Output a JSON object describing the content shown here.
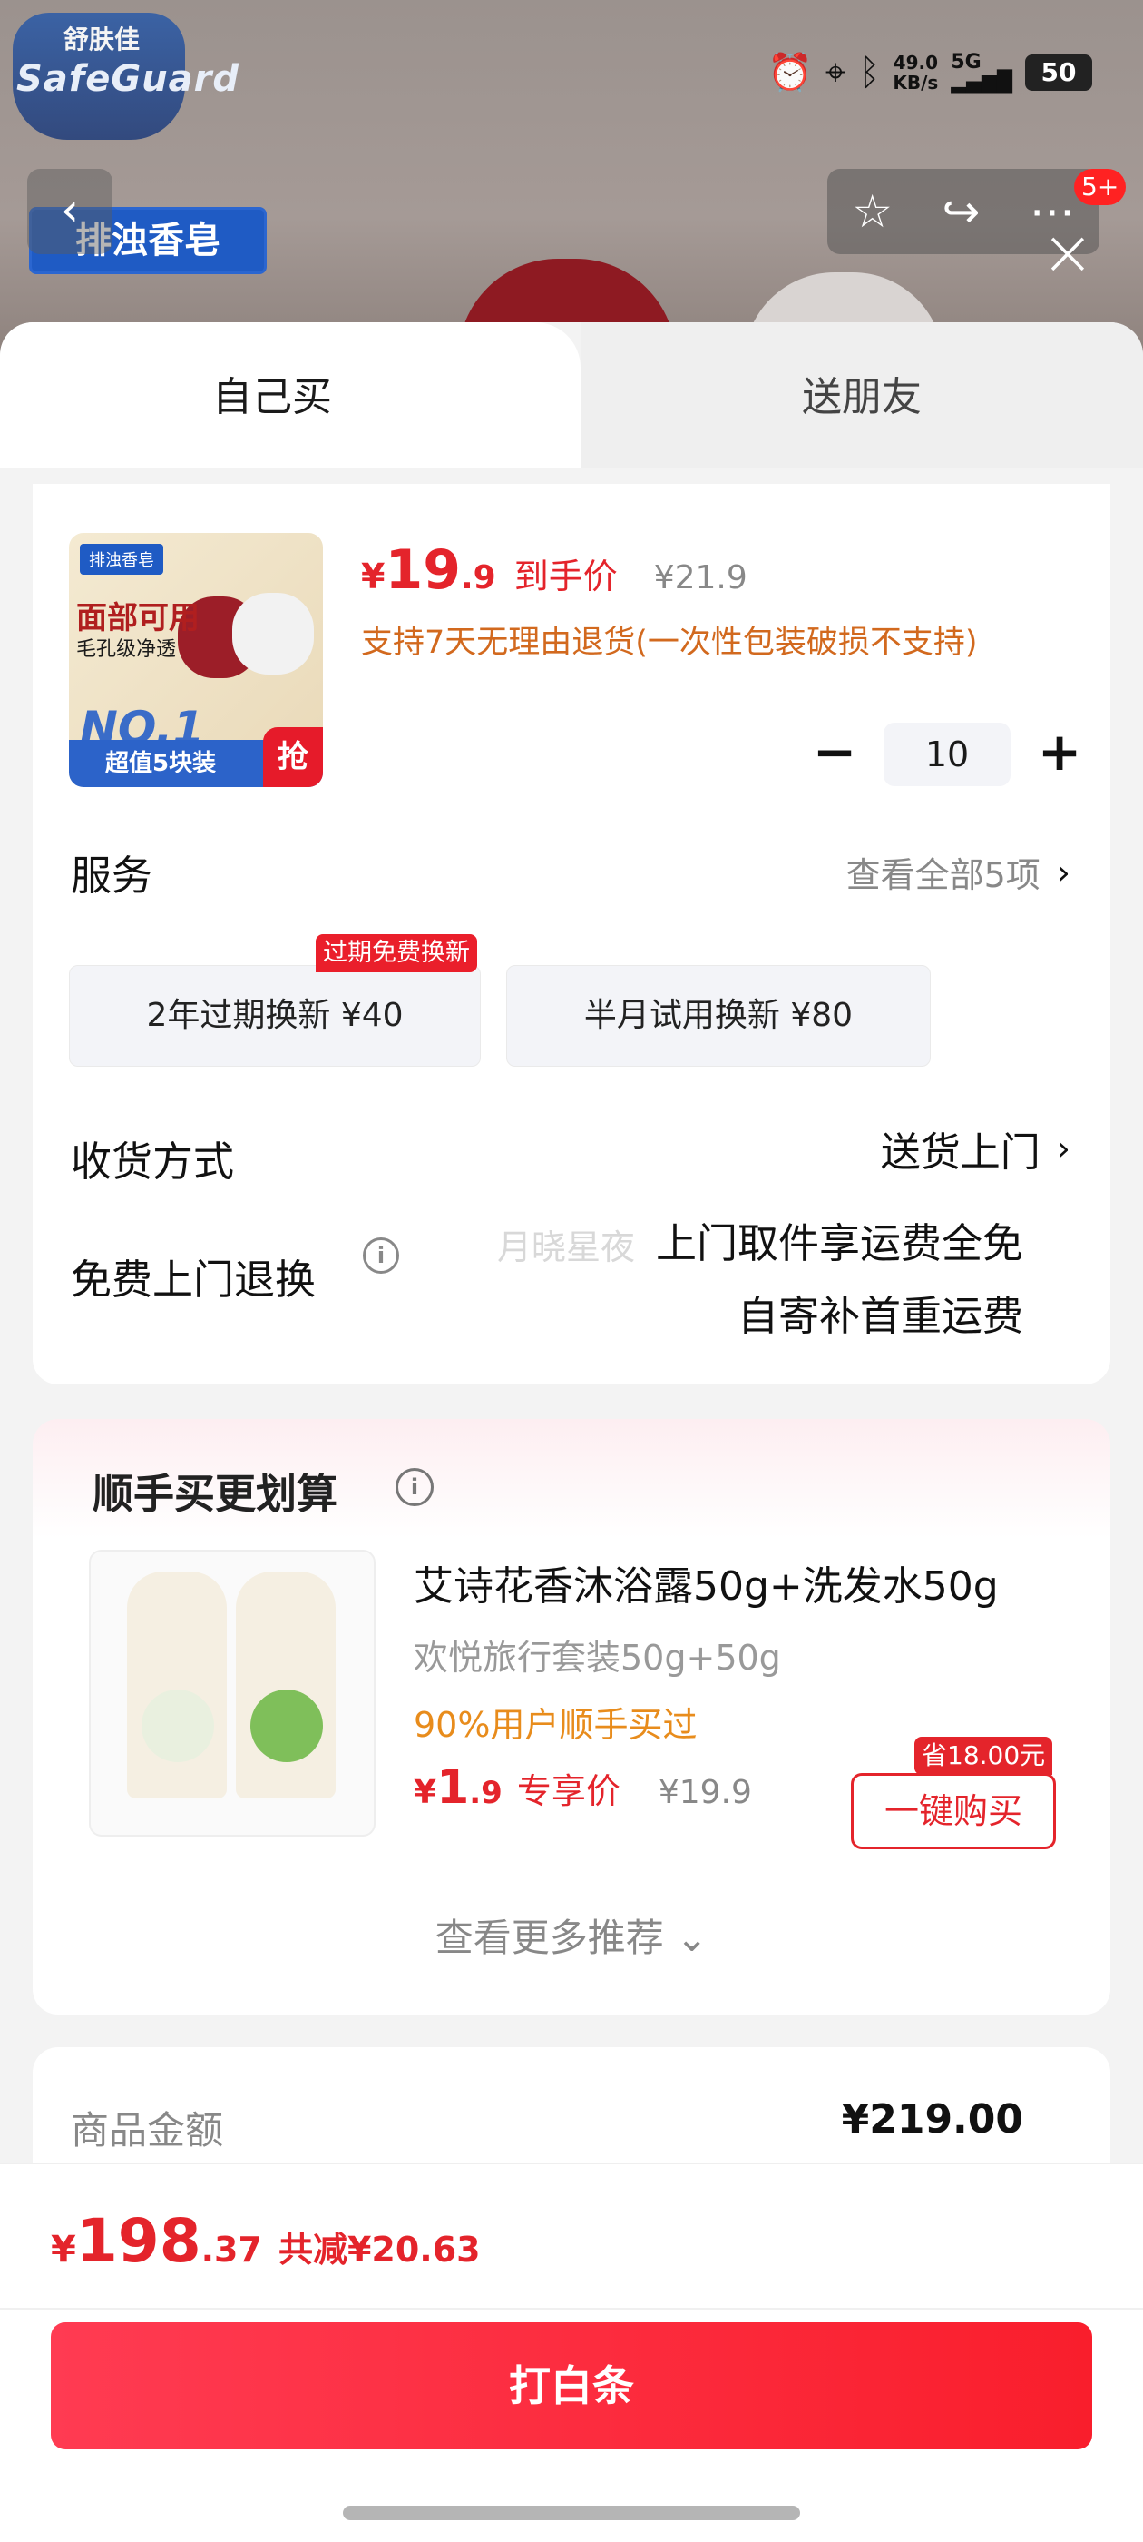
{
  "background": {
    "brand_name": "SafeGuard",
    "brand_cn": "舒肤佳",
    "badge": "排浊香皂"
  },
  "status_bar": {
    "net_speed_value": "49.0",
    "net_speed_unit": "KB/s",
    "network": "5G",
    "battery": "50"
  },
  "actions": {
    "notification_count": "5+"
  },
  "tabs": {
    "self": "自己买",
    "friend": "送朋友"
  },
  "product": {
    "image_tag": "排浊香皂",
    "image_line1": "面部可用",
    "image_line2": "毛孔级净透",
    "image_no1": "NO.1",
    "image_bar": "超值5块装",
    "image_grab": "抢",
    "currency": "¥",
    "price_int": "19",
    "price_dec": ".9",
    "price_label": "到手价",
    "original_price": "¥21.9",
    "return_note": "支持7天无理由退货(一次性包装破损不支持)",
    "quantity": "10",
    "minus": "−",
    "plus": "+"
  },
  "service": {
    "title": "服务",
    "view_all": "查看全部5项",
    "chevron": "›",
    "tag": "过期免费换新",
    "options": [
      {
        "label": "2年过期换新  ¥40"
      },
      {
        "label": "半月试用换新  ¥80"
      }
    ]
  },
  "shipping": {
    "title": "收货方式",
    "value": "送货上门",
    "chevron": "›"
  },
  "free_return": {
    "title": "免费上门退换",
    "info": "i",
    "line1": "上门取件享运费全免",
    "line2": "自寄补首重运费",
    "watermark": "月晓星夜"
  },
  "addon": {
    "title": "顺手买更划算",
    "info": "i",
    "name": "艾诗花香沐浴露50g+洗发水50g",
    "subtitle": "欢悦旅行套装50g+50g",
    "popularity": "90%用户顺手买过",
    "currency": "¥",
    "price_int": "1",
    "price_dec": ".9",
    "price_label": "专享价",
    "original_price": "¥19.9",
    "save_tag": "省18.00元",
    "buy_button": "一键购买",
    "more": "查看更多推荐 ⌄"
  },
  "summary": {
    "goods_amount_label": "商品金额",
    "goods_amount": "¥219.00"
  },
  "footer": {
    "currency": "¥",
    "total_int": "198",
    "total_dec": ".37",
    "reduction": "共减¥20.63",
    "pay_button": "打白条"
  },
  "colors": {
    "accent": "#e4242b",
    "orange": "#d2691e",
    "button_gradient_start": "#ff3b52",
    "button_gradient_end": "#f91e2c"
  }
}
